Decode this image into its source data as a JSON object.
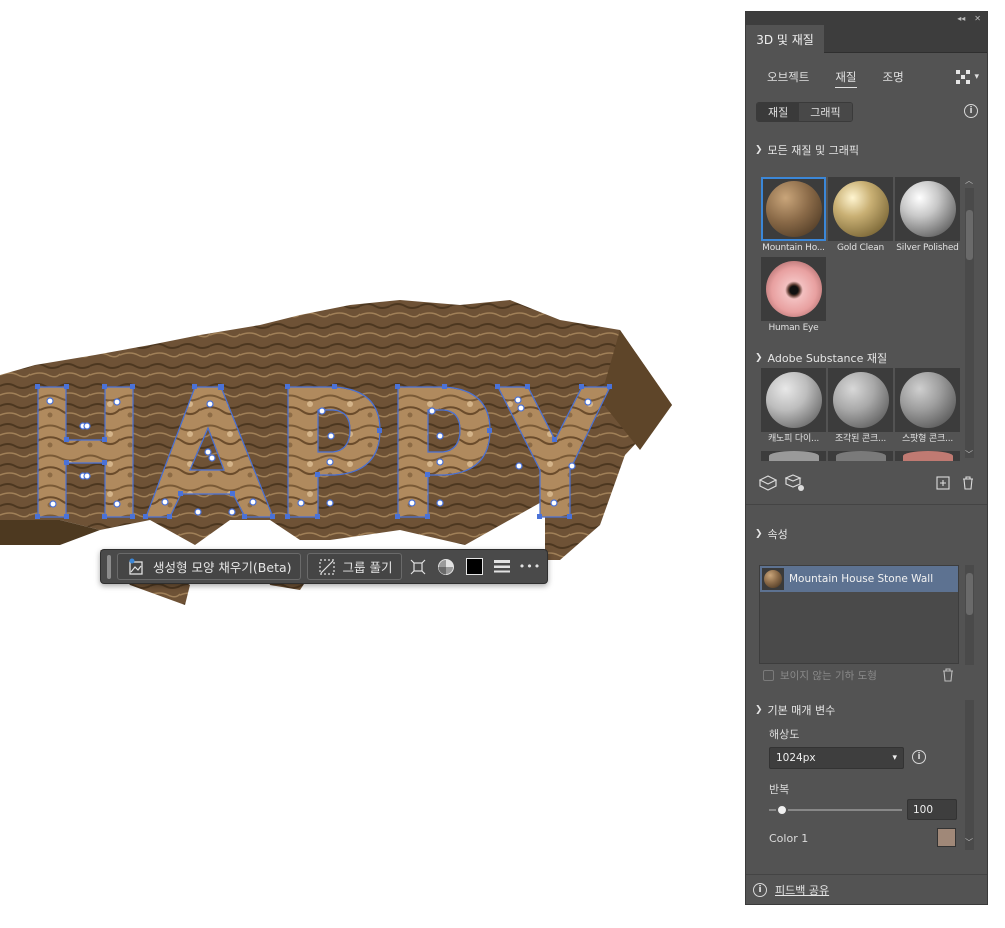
{
  "canvas": {
    "artwork_text": "HAPPY",
    "taskbar": {
      "generative_fill_label": "생성형 모양 채우기(Beta)",
      "ungroup_label": "그룹 풀기",
      "more_label": "•••"
    }
  },
  "panel": {
    "title": "3D 및 재질",
    "window_controls": {
      "collapse": "◂◂",
      "close": "✕"
    },
    "tabs": [
      {
        "label": "오브젝트"
      },
      {
        "label": "재질"
      },
      {
        "label": "조명"
      }
    ],
    "segmented": [
      {
        "label": "재질"
      },
      {
        "label": "그래픽"
      }
    ],
    "all_materials_header": "모든 재질 및 그래픽",
    "materials": [
      {
        "label": "Mountain Ho...",
        "color": "#8a6a48"
      },
      {
        "label": "Gold Clean",
        "color": "#c9b074"
      },
      {
        "label": "Silver Polished",
        "color": "#c8c8c8"
      },
      {
        "label": "Human Eye",
        "color": "#e8a0a0"
      }
    ],
    "substance_header": "Adobe Substance 재질",
    "substance_materials": [
      {
        "label": "캐노피 다이...",
        "color": "#bdbdbd"
      },
      {
        "label": "조각된 콘크...",
        "color": "#a9a9a9"
      },
      {
        "label": "스팟형 콘크...",
        "color": "#9d9d9d"
      }
    ],
    "properties_header": "속성",
    "layer_name": "Mountain House Stone Wall",
    "hidden_geometry_label": "보이지 않는 기하 도형",
    "basic_params_header": "기본 매개 변수",
    "resolution_label": "해상도",
    "resolution_value": "1024px",
    "repeat_label": "반복",
    "repeat_value": "100",
    "repeat_fraction": 0.1,
    "color1_label": "Color 1",
    "color1_value": "#a08878",
    "feedback_label": "피드백 공유"
  }
}
